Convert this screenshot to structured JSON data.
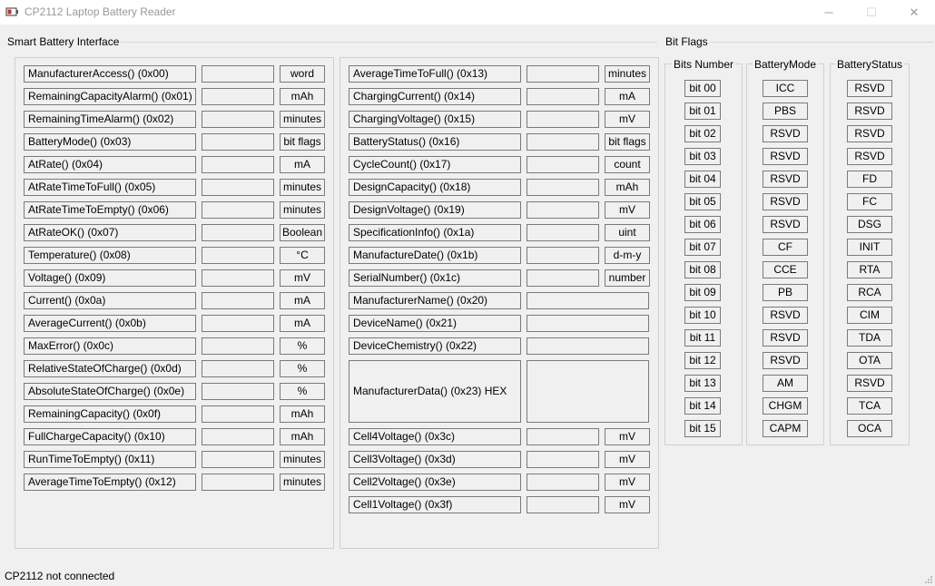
{
  "window": {
    "title": "CP2112 Laptop Battery Reader",
    "minimize_glyph": "─",
    "maximize_glyph": "☐",
    "close_glyph": "✕"
  },
  "smart_battery": {
    "group_label": "Smart Battery Interface",
    "left_rows": [
      {
        "label": "ManufacturerAccess() (0x00)",
        "unit": "word"
      },
      {
        "label": "RemainingCapacityAlarm() (0x01)",
        "unit": "mAh"
      },
      {
        "label": "RemainingTimeAlarm() (0x02)",
        "unit": "minutes"
      },
      {
        "label": "BatteryMode() (0x03)",
        "unit": "bit flags"
      },
      {
        "label": "AtRate() (0x04)",
        "unit": "mA"
      },
      {
        "label": "AtRateTimeToFull() (0x05)",
        "unit": "minutes"
      },
      {
        "label": "AtRateTimeToEmpty() (0x06)",
        "unit": "minutes"
      },
      {
        "label": "AtRateOK() (0x07)",
        "unit": "Boolean"
      },
      {
        "label": "Temperature() (0x08)",
        "unit": "°C"
      },
      {
        "label": "Voltage() (0x09)",
        "unit": "mV"
      },
      {
        "label": "Current() (0x0a)",
        "unit": "mA"
      },
      {
        "label": "AverageCurrent() (0x0b)",
        "unit": "mA"
      },
      {
        "label": "MaxError() (0x0c)",
        "unit": "%"
      },
      {
        "label": "RelativeStateOfCharge() (0x0d)",
        "unit": "%"
      },
      {
        "label": "AbsoluteStateOfCharge() (0x0e)",
        "unit": "%"
      },
      {
        "label": "RemainingCapacity() (0x0f)",
        "unit": "mAh"
      },
      {
        "label": "FullChargeCapacity() (0x10)",
        "unit": "mAh"
      },
      {
        "label": "RunTimeToEmpty() (0x11)",
        "unit": "minutes"
      },
      {
        "label": "AverageTimeToEmpty() (0x12)",
        "unit": "minutes"
      }
    ],
    "right_rows": [
      {
        "label": "AverageTimeToFull() (0x13)",
        "unit": "minutes"
      },
      {
        "label": "ChargingCurrent() (0x14)",
        "unit": "mA"
      },
      {
        "label": "ChargingVoltage() (0x15)",
        "unit": "mV"
      },
      {
        "label": "BatteryStatus() (0x16)",
        "unit": "bit flags"
      },
      {
        "label": "CycleCount() (0x17)",
        "unit": "count"
      },
      {
        "label": "DesignCapacity() (0x18)",
        "unit": "mAh"
      },
      {
        "label": "DesignVoltage() (0x19)",
        "unit": "mV"
      },
      {
        "label": "SpecificationInfo() (0x1a)",
        "unit": "uint"
      },
      {
        "label": "ManufactureDate() (0x1b)",
        "unit": "d-m-y"
      },
      {
        "label": "SerialNumber() (0x1c)",
        "unit": "number"
      },
      {
        "label": "ManufacturerName() (0x20)",
        "unit": ""
      },
      {
        "label": "DeviceName() (0x21)",
        "unit": ""
      },
      {
        "label": "DeviceChemistry() (0x22)",
        "unit": ""
      }
    ],
    "manufacturer_data_label": "ManufacturerData() (0x23)  HEX",
    "cell_rows": [
      {
        "label": "Cell4Voltage() (0x3c)",
        "unit": "mV"
      },
      {
        "label": "Cell3Voltage() (0x3d)",
        "unit": "mV"
      },
      {
        "label": "Cell2Voltage() (0x3e)",
        "unit": "mV"
      },
      {
        "label": "Cell1Voltage() (0x3f)",
        "unit": "mV"
      }
    ]
  },
  "bit_flags": {
    "group_label": "Bit Flags",
    "headers": [
      "Bits Number",
      "BatteryMode",
      "BatteryStatus"
    ],
    "bits": [
      "bit 00",
      "bit 01",
      "bit 02",
      "bit 03",
      "bit 04",
      "bit 05",
      "bit 06",
      "bit 07",
      "bit 08",
      "bit 09",
      "bit 10",
      "bit 11",
      "bit 12",
      "bit 13",
      "bit 14",
      "bit 15"
    ],
    "battery_mode": [
      "ICC",
      "PBS",
      "RSVD",
      "RSVD",
      "RSVD",
      "RSVD",
      "RSVD",
      "CF",
      "CCE",
      "PB",
      "RSVD",
      "RSVD",
      "RSVD",
      "AM",
      "CHGM",
      "CAPM"
    ],
    "battery_status": [
      "RSVD",
      "RSVD",
      "RSVD",
      "RSVD",
      "FD",
      "FC",
      "DSG",
      "INIT",
      "RTA",
      "RCA",
      "CIM",
      "TDA",
      "OTA",
      "RSVD",
      "TCA",
      "OCA"
    ]
  },
  "status_bar": {
    "text": "CP2112 not connected"
  }
}
